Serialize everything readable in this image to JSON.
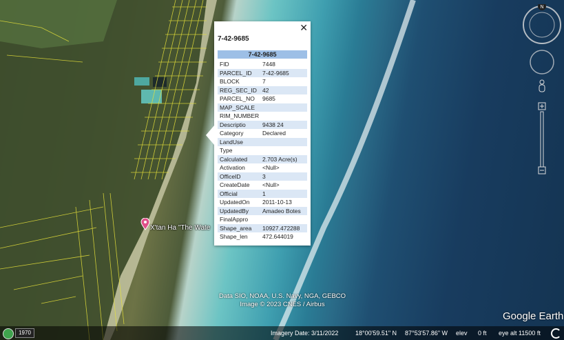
{
  "popup": {
    "title": "7-42-9685",
    "table_header": "7-42-9685",
    "close_glyph": "✕",
    "rows": [
      {
        "key": "FID",
        "value": "7448"
      },
      {
        "key": "PARCEL_ID",
        "value": "7-42-9685"
      },
      {
        "key": "BLOCK",
        "value": "7"
      },
      {
        "key": "REG_SEC_ID",
        "value": "42"
      },
      {
        "key": "PARCEL_NO",
        "value": "9685"
      },
      {
        "key": "MAP_SCALE",
        "value": ""
      },
      {
        "key": "RIM_NUMBER",
        "value": ""
      },
      {
        "key": "Descriptio",
        "value": "9438 24"
      },
      {
        "key": "Category",
        "value": "Declared"
      },
      {
        "key": "LandUse",
        "value": ""
      },
      {
        "key": "Type",
        "value": ""
      },
      {
        "key": "Calculated",
        "value": "2.703 Acre(s)"
      },
      {
        "key": "Activation",
        "value": "<Null>"
      },
      {
        "key": "OfficeID",
        "value": "3"
      },
      {
        "key": "CreateDate",
        "value": "<Null>"
      },
      {
        "key": "Official",
        "value": "1"
      },
      {
        "key": "UpdatedOn",
        "value": "2011-10-13"
      },
      {
        "key": "UpdatedBy",
        "value": "Amadeo Botes"
      },
      {
        "key": "FinalAppro",
        "value": ""
      },
      {
        "key": "Shape_area",
        "value": "10927.472288"
      },
      {
        "key": "Shape_len",
        "value": "472.644019"
      }
    ]
  },
  "map": {
    "place_label": "X'tan Ha \"The Wate",
    "credits_line1": "Data SIO, NOAA, U.S. Navy, NGA, GEBCO",
    "credits_line2": "Image © 2023 CNES / Airbus",
    "logo": "Google Earth",
    "compass_letter": "N",
    "pin_icon": "placemark-pin-icon"
  },
  "statusbar": {
    "year": "1970",
    "imagery_date": "Imagery Date: 3/11/2022",
    "latitude": "18°00'59.51\" N",
    "longitude": "87°53'57.86\" W",
    "elev_label": "elev",
    "elev_value": "0 ft",
    "eye_alt": "eye alt  11500 ft"
  },
  "colors": {
    "parcel_lines": "#e8e23a",
    "popup_header": "#9dbfe6",
    "popup_alt_row": "#dbe7f5"
  }
}
